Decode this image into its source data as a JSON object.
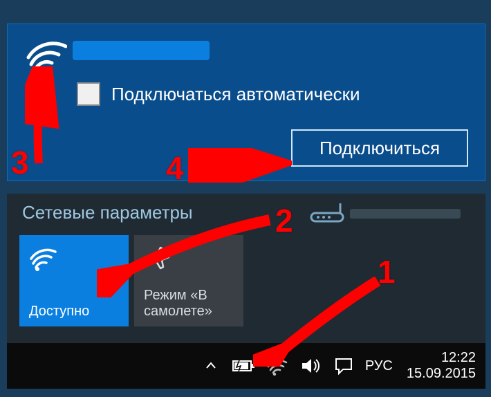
{
  "network": {
    "auto_connect_label": "Подключаться автоматически",
    "connect_button": "Подключиться"
  },
  "settings": {
    "title": "Сетевые параметры"
  },
  "tiles": {
    "wifi_label": "Доступно",
    "airplane_label": "Режим «В самолете»"
  },
  "tray": {
    "language": "РУС",
    "time": "12:22",
    "date": "15.09.2015"
  },
  "annotations": {
    "n1": "1",
    "n2": "2",
    "n3": "3",
    "n4": "4"
  }
}
